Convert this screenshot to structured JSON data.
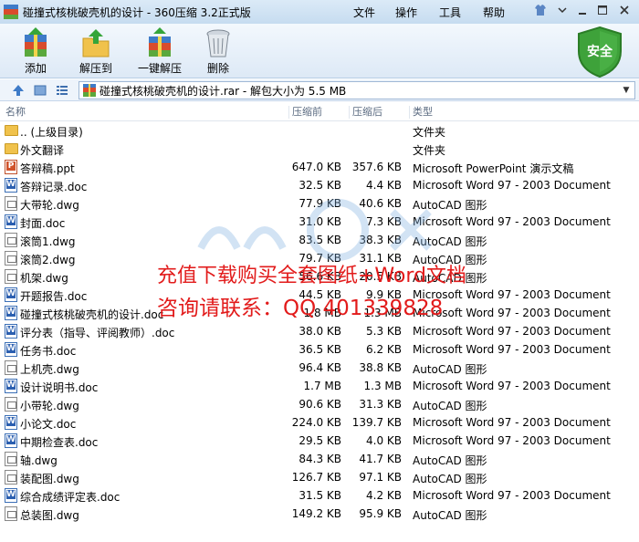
{
  "window": {
    "title": "碰撞式核桃破壳机的设计 - 360压缩 3.2正式版",
    "menu": [
      "文件",
      "操作",
      "工具",
      "帮助"
    ]
  },
  "toolbar": {
    "buttons": [
      {
        "label": "添加",
        "icon": "add-archive-icon"
      },
      {
        "label": "解压到",
        "icon": "extract-to-icon"
      },
      {
        "label": "一键解压",
        "icon": "one-click-extract-icon"
      },
      {
        "label": "删除",
        "icon": "delete-icon"
      }
    ],
    "security_badge": "安全"
  },
  "address": {
    "text": "碰撞式核桃破壳机的设计.rar - 解包大小为 5.5 MB"
  },
  "columns": [
    "名称",
    "压缩前",
    "压缩后",
    "类型"
  ],
  "files": [
    {
      "name": ".. (上级目录)",
      "before": "",
      "after": "",
      "type": "文件夹",
      "kind": "folder"
    },
    {
      "name": "外文翻译",
      "before": "",
      "after": "",
      "type": "文件夹",
      "kind": "folder"
    },
    {
      "name": "答辩稿.ppt",
      "before": "647.0 KB",
      "after": "357.6 KB",
      "type": "Microsoft PowerPoint 演示文稿",
      "kind": "ppt"
    },
    {
      "name": "答辩记录.doc",
      "before": "32.5 KB",
      "after": "4.4 KB",
      "type": "Microsoft Word 97 - 2003 Document",
      "kind": "doc"
    },
    {
      "name": "大带轮.dwg",
      "before": "77.9 KB",
      "after": "40.6 KB",
      "type": "AutoCAD 图形",
      "kind": "dwg"
    },
    {
      "name": "封面.doc",
      "before": "31.0 KB",
      "after": "7.3 KB",
      "type": "Microsoft Word 97 - 2003 Document",
      "kind": "doc"
    },
    {
      "name": "滚筒1.dwg",
      "before": "83.5 KB",
      "after": "38.3 KB",
      "type": "AutoCAD 图形",
      "kind": "dwg"
    },
    {
      "name": "滚筒2.dwg",
      "before": "79.7 KB",
      "after": "31.1 KB",
      "type": "AutoCAD 图形",
      "kind": "dwg"
    },
    {
      "name": "机架.dwg",
      "before": "56.6 KB",
      "after": "20.5 KB",
      "type": "AutoCAD 图形",
      "kind": "dwg"
    },
    {
      "name": "开题报告.doc",
      "before": "44.5 KB",
      "after": "9.9 KB",
      "type": "Microsoft Word 97 - 2003 Document",
      "kind": "doc"
    },
    {
      "name": "碰撞式核桃破壳机的设计.doc",
      "before": "1.8 MB",
      "after": "1.3 MB",
      "type": "Microsoft Word 97 - 2003 Document",
      "kind": "doc"
    },
    {
      "name": "评分表（指导、评阅教师）.doc",
      "before": "38.0 KB",
      "after": "5.3 KB",
      "type": "Microsoft Word 97 - 2003 Document",
      "kind": "doc"
    },
    {
      "name": "任务书.doc",
      "before": "36.5 KB",
      "after": "6.2 KB",
      "type": "Microsoft Word 97 - 2003 Document",
      "kind": "doc"
    },
    {
      "name": "上机壳.dwg",
      "before": "96.4 KB",
      "after": "38.8 KB",
      "type": "AutoCAD 图形",
      "kind": "dwg"
    },
    {
      "name": "设计说明书.doc",
      "before": "1.7 MB",
      "after": "1.3 MB",
      "type": "Microsoft Word 97 - 2003 Document",
      "kind": "doc"
    },
    {
      "name": "小带轮.dwg",
      "before": "90.6 KB",
      "after": "31.3 KB",
      "type": "AutoCAD 图形",
      "kind": "dwg"
    },
    {
      "name": "小论文.doc",
      "before": "224.0 KB",
      "after": "139.7 KB",
      "type": "Microsoft Word 97 - 2003 Document",
      "kind": "doc"
    },
    {
      "name": "中期检查表.doc",
      "before": "29.5 KB",
      "after": "4.0 KB",
      "type": "Microsoft Word 97 - 2003 Document",
      "kind": "doc"
    },
    {
      "name": "轴.dwg",
      "before": "84.3 KB",
      "after": "41.7 KB",
      "type": "AutoCAD 图形",
      "kind": "dwg"
    },
    {
      "name": "装配图.dwg",
      "before": "126.7 KB",
      "after": "97.1 KB",
      "type": "AutoCAD 图形",
      "kind": "dwg"
    },
    {
      "name": "综合成绩评定表.doc",
      "before": "31.5 KB",
      "after": "4.2 KB",
      "type": "Microsoft Word 97 - 2003 Document",
      "kind": "doc"
    },
    {
      "name": "总装图.dwg",
      "before": "149.2 KB",
      "after": "95.9 KB",
      "type": "AutoCAD 图形",
      "kind": "dwg"
    }
  ],
  "watermark": {
    "line1": "充值下载购买全套图纸+Word文档",
    "line2": "咨询请联系：QQ 401339828"
  },
  "colors": {
    "accent": "#3e7bc8",
    "watermark_text": "#e21b1b",
    "shield": "#3ea23a"
  }
}
